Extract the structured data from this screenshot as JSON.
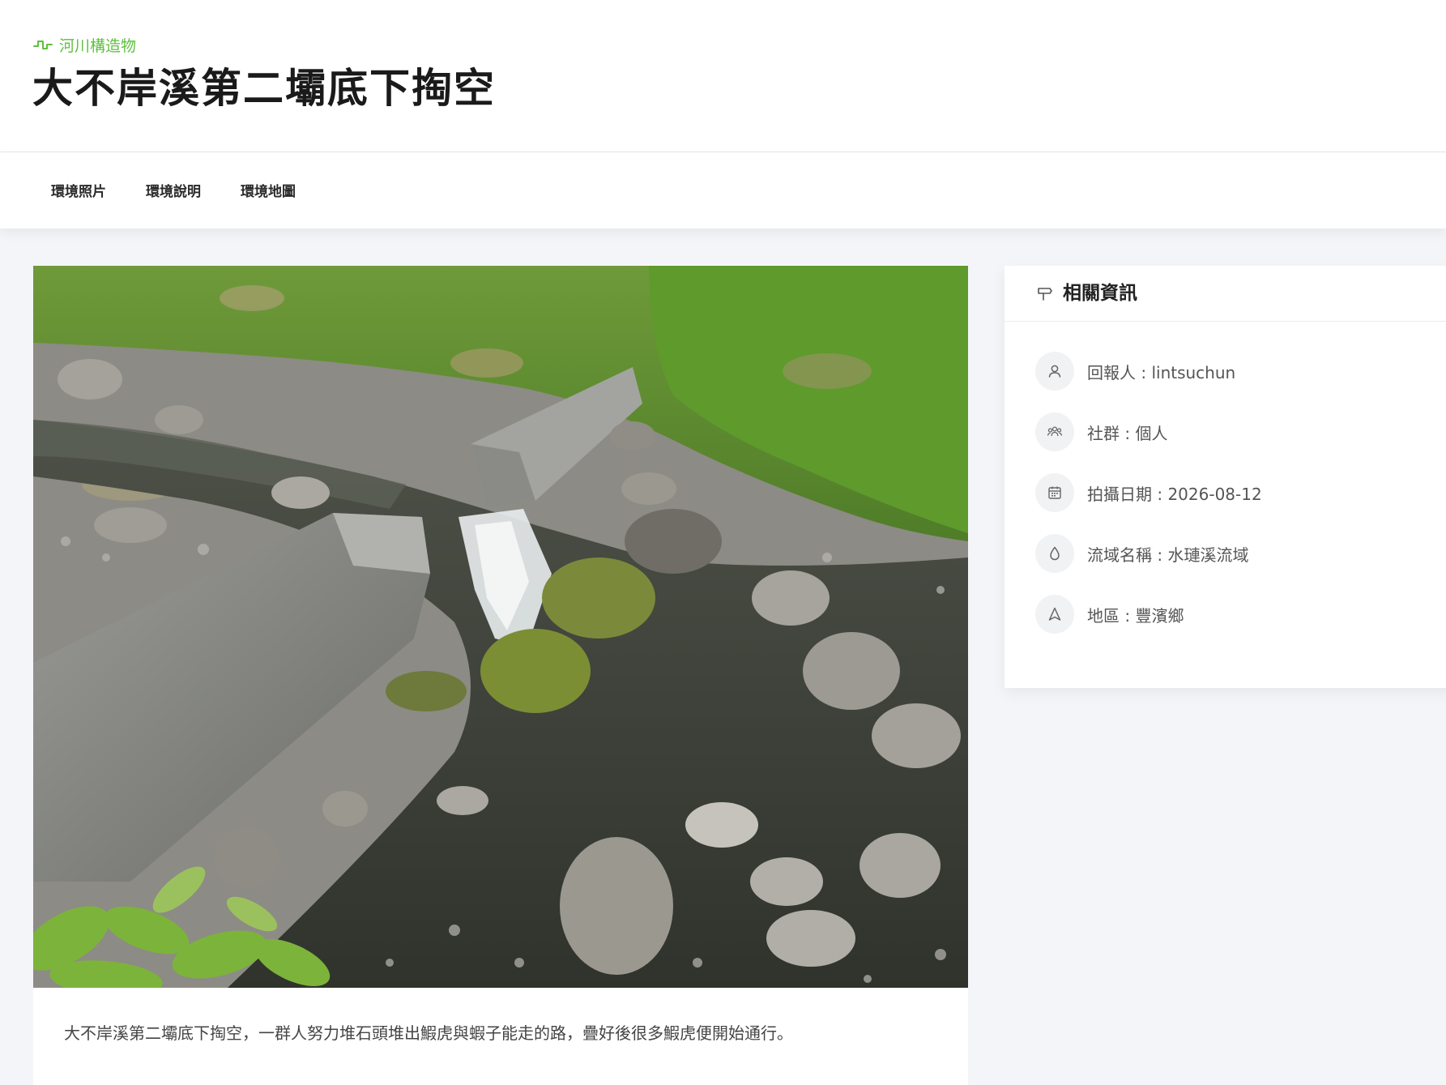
{
  "header": {
    "category_icon": "pulse-icon",
    "category_label": "河川構造物",
    "title": "大不岸溪第二壩底下掏空",
    "accent_color": "#5fbf3f"
  },
  "tabs": [
    {
      "label": "環境照片"
    },
    {
      "label": "環境說明"
    },
    {
      "label": "環境地圖"
    }
  ],
  "photo": {
    "content": "river-weir-photo"
  },
  "description": {
    "text": "大不岸溪第二壩底下掏空，一群人努力堆石頭堆出鰕虎與蝦子能走的路，疊好後很多鰕虎便開始通行。"
  },
  "info": {
    "title": "相關資訊",
    "title_icon": "signpost-icon",
    "rows": [
      {
        "icon": "user-icon",
        "label": "回報人 : lintsuchun"
      },
      {
        "icon": "group-icon",
        "label": "社群 : 個人"
      },
      {
        "icon": "calendar-icon",
        "label": "拍攝日期 : 2026-08-12"
      },
      {
        "icon": "water-drop-icon",
        "label": "流域名稱 : 水璉溪流域"
      },
      {
        "icon": "navigation-icon",
        "label": "地區 : 豐濱鄉"
      }
    ]
  }
}
